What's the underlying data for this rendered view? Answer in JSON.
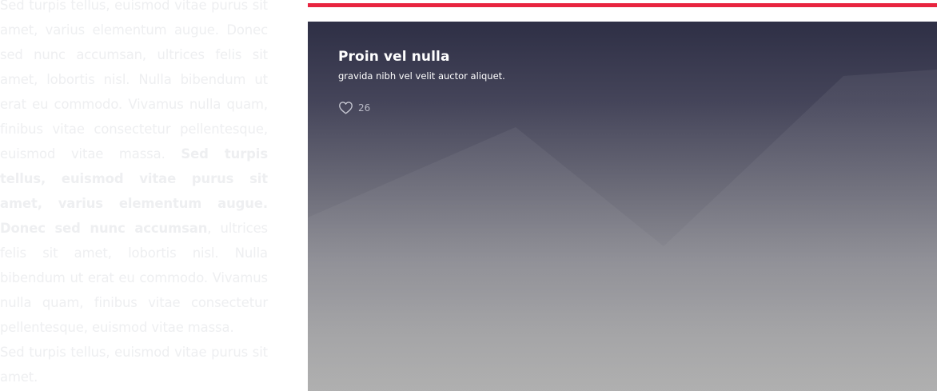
{
  "left_text": {
    "p1_start": "Sed turpis tellus, euismod vitae purus sit amet, varius elementum augue. Donec sed nunc accumsan, ultrices felis sit amet, lobortis nisl. Nulla bibendum ut erat eu commodo. Vivamus nulla quam, finibus vitae consectetur pellentesque, euismod vitae massa. ",
    "p1_bold": "Sed turpis tellus, euismod vitae purus sit amet, varius elementum augue. Donec sed nunc accumsan",
    "p1_end": ", ultrices felis sit amet, lobortis nisl. Nulla bibendum ut erat eu commodo. Vivamus nulla quam, finibus vitae consectetur pellentesque, euismod vitae massa.",
    "p2": "Sed turpis tellus, euismod vitae purus sit amet."
  },
  "accent_color": "#e8243f",
  "card": {
    "title": "Proin vel nulla",
    "subtitle": "gravida nibh vel velit auctor aliquet.",
    "likes_icon": "heart-outline-icon",
    "likes_count": "26"
  }
}
